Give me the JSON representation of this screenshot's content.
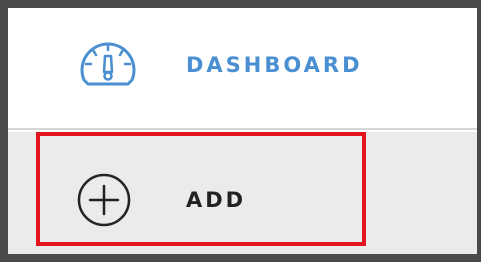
{
  "menu": {
    "items": [
      {
        "label": "DASHBOARD",
        "icon": "dashboard-gauge-icon",
        "color": "#4a8fd1",
        "selected": false
      },
      {
        "label": "ADD",
        "icon": "plus-circle-icon",
        "color": "#222222",
        "selected": true
      }
    ]
  },
  "colors": {
    "accent": "#4a8fd1",
    "highlight": "#e3141b",
    "frame": "#4a4a4a",
    "selected_background": "#ebebeb"
  }
}
